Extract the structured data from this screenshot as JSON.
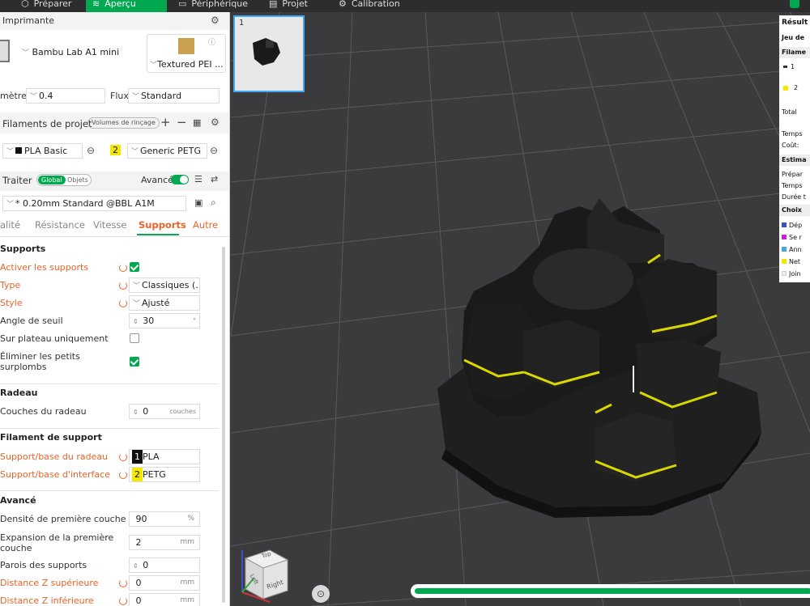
{
  "topbar": {
    "tabs": [
      {
        "label": "Préparer",
        "icon": "cube-icon"
      },
      {
        "label": "Aperçu",
        "icon": "layers-icon",
        "active": true
      },
      {
        "label": "Périphérique",
        "icon": "device-icon"
      },
      {
        "label": "Projet",
        "icon": "folder-icon"
      },
      {
        "label": "Calibration",
        "icon": "calibration-icon"
      }
    ]
  },
  "printer": {
    "section_title": "Imprimante",
    "name": "Bambu Lab A1 mini",
    "plate": "Textured PEI ...",
    "nozzle_label": "mètre",
    "nozzle_value": "0.4",
    "flow_label": "Flux",
    "flow_value": "Standard"
  },
  "filaments": {
    "title": "Filaments de projet",
    "flush_button": "Volumes de rinçage",
    "items": [
      {
        "index": "1",
        "name": "PLA Basic",
        "color": "#111111"
      },
      {
        "index": "2",
        "name": "Generic PETG",
        "color": "#f5e800"
      }
    ]
  },
  "process": {
    "title": "Traiter",
    "toggle_global": "Global",
    "toggle_objects": "Objets",
    "advanced_label": "Avancé",
    "advanced_on": true,
    "preset": "* 0.20mm Standard @BBL A1M",
    "tabs": [
      "alité",
      "Résistance",
      "Vitesse",
      "Supports",
      "Autre"
    ],
    "active_tab": "Supports"
  },
  "supports": {
    "group_title": "Supports",
    "enable_label": "Activer les supports",
    "type_label": "Type",
    "type_value": "Classiques (...",
    "style_label": "Style",
    "style_value": "Ajusté",
    "threshold_label": "Angle de seuil",
    "threshold_value": "30",
    "threshold_unit": "°",
    "build_plate_label": "Sur plateau uniquement",
    "remove_small_label_1": "Éliminer les petits",
    "remove_small_label_2": "surplombs"
  },
  "raft": {
    "group_title": "Radeau",
    "layers_label": "Couches du radeau",
    "layers_value": "0",
    "layers_unit": "couches"
  },
  "support_filament": {
    "group_title": "Filament de support",
    "base_label": "Support/base du radeau",
    "base_index": "1",
    "base_value": "PLA",
    "interface_label": "Support/base d'interface",
    "interface_index": "2",
    "interface_value": "PETG"
  },
  "advanced": {
    "group_title": "Avancé",
    "density_label": "Densité de première couche",
    "density_value": "90",
    "density_unit": "%",
    "expansion_label_1": "Expansion de la première",
    "expansion_label_2": "couche",
    "expansion_value": "2",
    "expansion_unit": "mm",
    "walls_label": "Parois des supports",
    "walls_value": "0",
    "top_z_label": "Distance Z supérieure",
    "top_z_value": "0",
    "top_z_unit": "mm",
    "bottom_z_label": "Distance Z inférieure",
    "bottom_z_value": "0",
    "bottom_z_unit": "mm"
  },
  "viewport": {
    "plate_number": "1",
    "cube_top": "Top",
    "cube_front": "Left",
    "cube_right": "Right",
    "progress": 1.0
  },
  "results": {
    "title": "Résult",
    "set": "Jeu de",
    "filament_head": "Filame",
    "f1": "1",
    "f2": "2",
    "total": "Total",
    "time": "Temps",
    "cost": "Coût:",
    "estimation": "Estima",
    "prep": "Prépar",
    "time2": "Temps",
    "duration": "Durée t",
    "choice": "Choix",
    "legend": [
      {
        "label": "Dép",
        "color": "#3355cc"
      },
      {
        "label": "Se r",
        "color": "#cc22cc"
      },
      {
        "label": "Ann",
        "color": "#44aadd"
      },
      {
        "label": "Net",
        "color": "#f5e800"
      },
      {
        "label": "Join",
        "color": "#eeeeee"
      }
    ]
  }
}
